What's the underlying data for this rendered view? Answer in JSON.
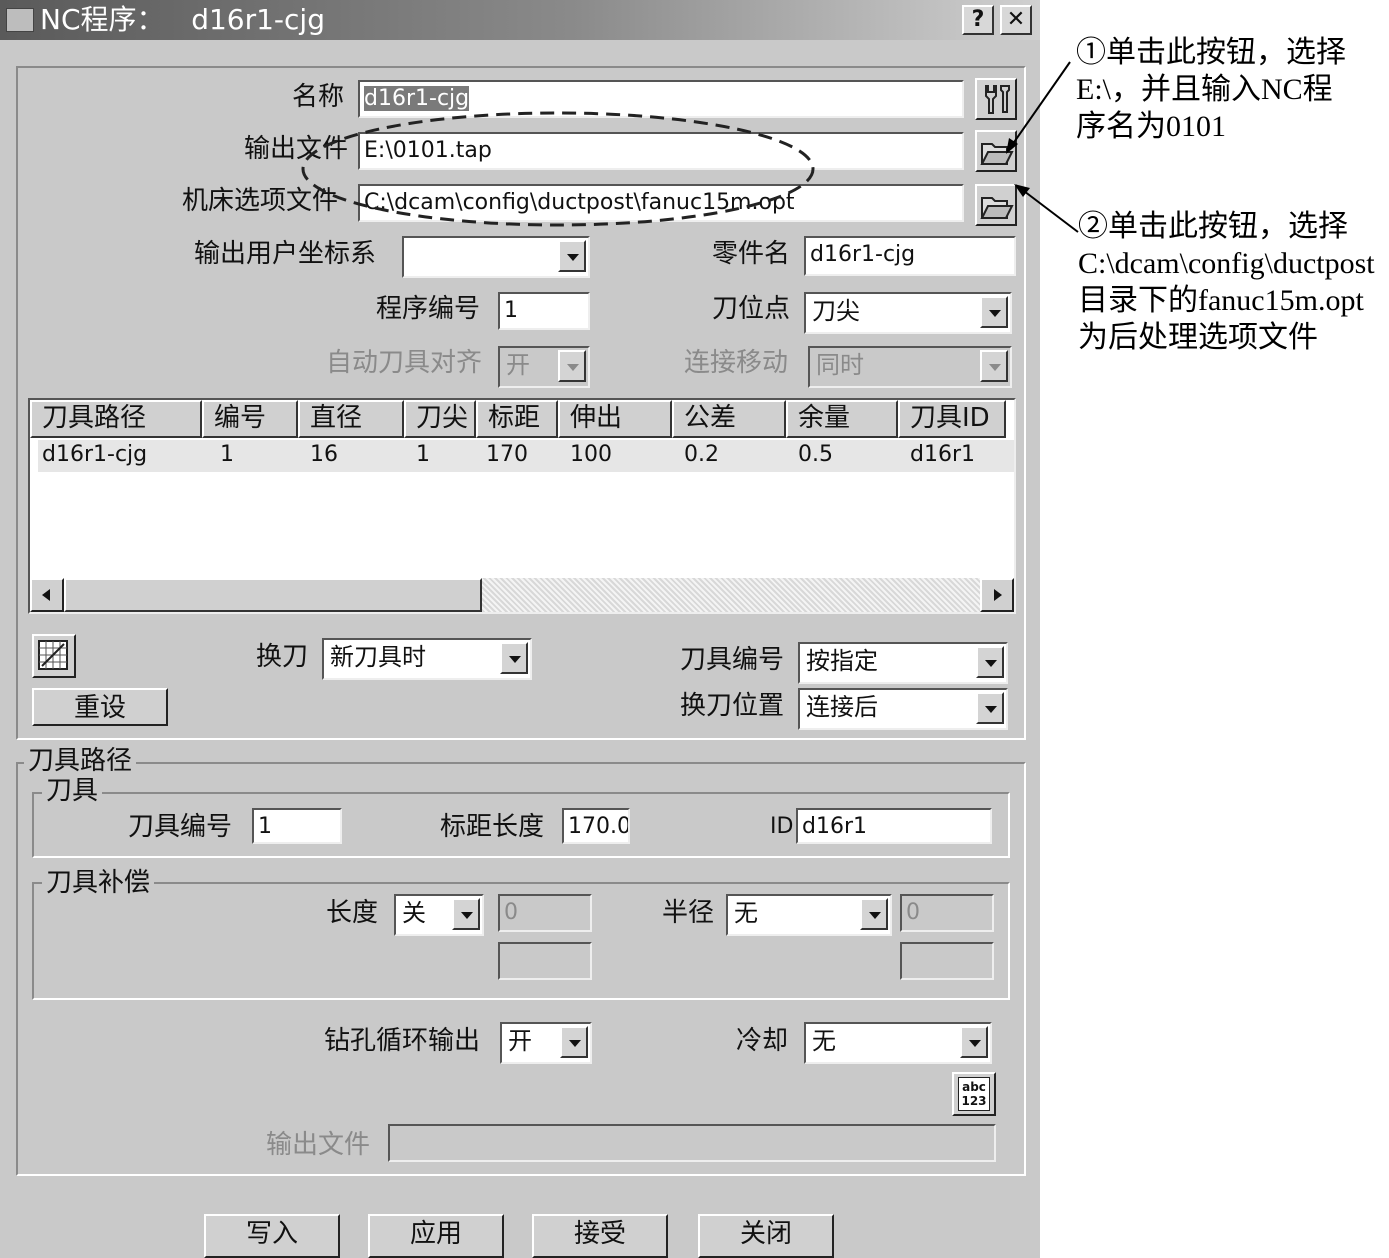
{
  "window": {
    "title": "NC程序：   d16r1-cjg",
    "help_label": "?",
    "close_label": "✕"
  },
  "form": {
    "name_label": "名称",
    "name_value": "d16r1-cjg",
    "output_file_label": "输出文件",
    "output_file_value": "E:\\0101.tap",
    "option_file_label": "机床选项文件",
    "option_file_value": "C:\\dcam\\config\\ductpost\\fanuc15m.opt",
    "ucs_label": "输出用户坐标系",
    "ucs_value": "",
    "part_name_label": "零件名",
    "part_name_value": "d16r1-cjg",
    "program_no_label": "程序编号",
    "program_no_value": "1",
    "tool_point_label": "刀位点",
    "tool_point_value": "刀尖",
    "auto_align_label": "自动刀具对齐",
    "auto_align_value": "开",
    "link_move_label": "连接移动",
    "link_move_value": "同时"
  },
  "table": {
    "columns": [
      "刀具路径",
      "编号",
      "直径",
      "刀尖",
      "标距",
      "伸出",
      "公差",
      "余量",
      "刀具ID"
    ],
    "rows": [
      [
        "d16r1-cjg",
        "1",
        "16",
        "1",
        "170",
        "100",
        "0.2",
        "0.5",
        "d16r1"
      ]
    ]
  },
  "tool_change": {
    "change_label": "换刀",
    "change_value": "新刀具时",
    "tool_number_label": "刀具编号",
    "tool_number_value": "按指定",
    "position_label": "换刀位置",
    "position_value": "连接后",
    "reset_label": "重设"
  },
  "toolpath": {
    "group_label": "刀具路径",
    "tool_group_label": "刀具",
    "tool_no_label": "刀具编号",
    "tool_no_value": "1",
    "gauge_label": "标距长度",
    "gauge_value": "170.0",
    "id_label": "ID",
    "id_value": "d16r1",
    "comp_group_label": "刀具补偿",
    "length_label": "长度",
    "length_value": "关",
    "length_amount": "0",
    "radius_label": "半径",
    "radius_value": "无",
    "radius_amount": "0",
    "drill_label": "钻孔循环输出",
    "drill_value": "开",
    "coolant_label": "冷却",
    "coolant_value": "无",
    "abc_icon_text": "abc\n123",
    "out_file_label": "输出文件",
    "out_file_value": ""
  },
  "buttons": {
    "write": "写入",
    "apply": "应用",
    "accept": "接受",
    "close": "关闭"
  },
  "annotations": {
    "note1": "①单击此按钮，选择\nE:\\，并且输入NC程\n序名为0101",
    "note2": "②单击此按钮，选择\nC:\\dcam\\config\\ductpost\n目录下的fanuc15m.opt\n为后处理选项文件"
  }
}
